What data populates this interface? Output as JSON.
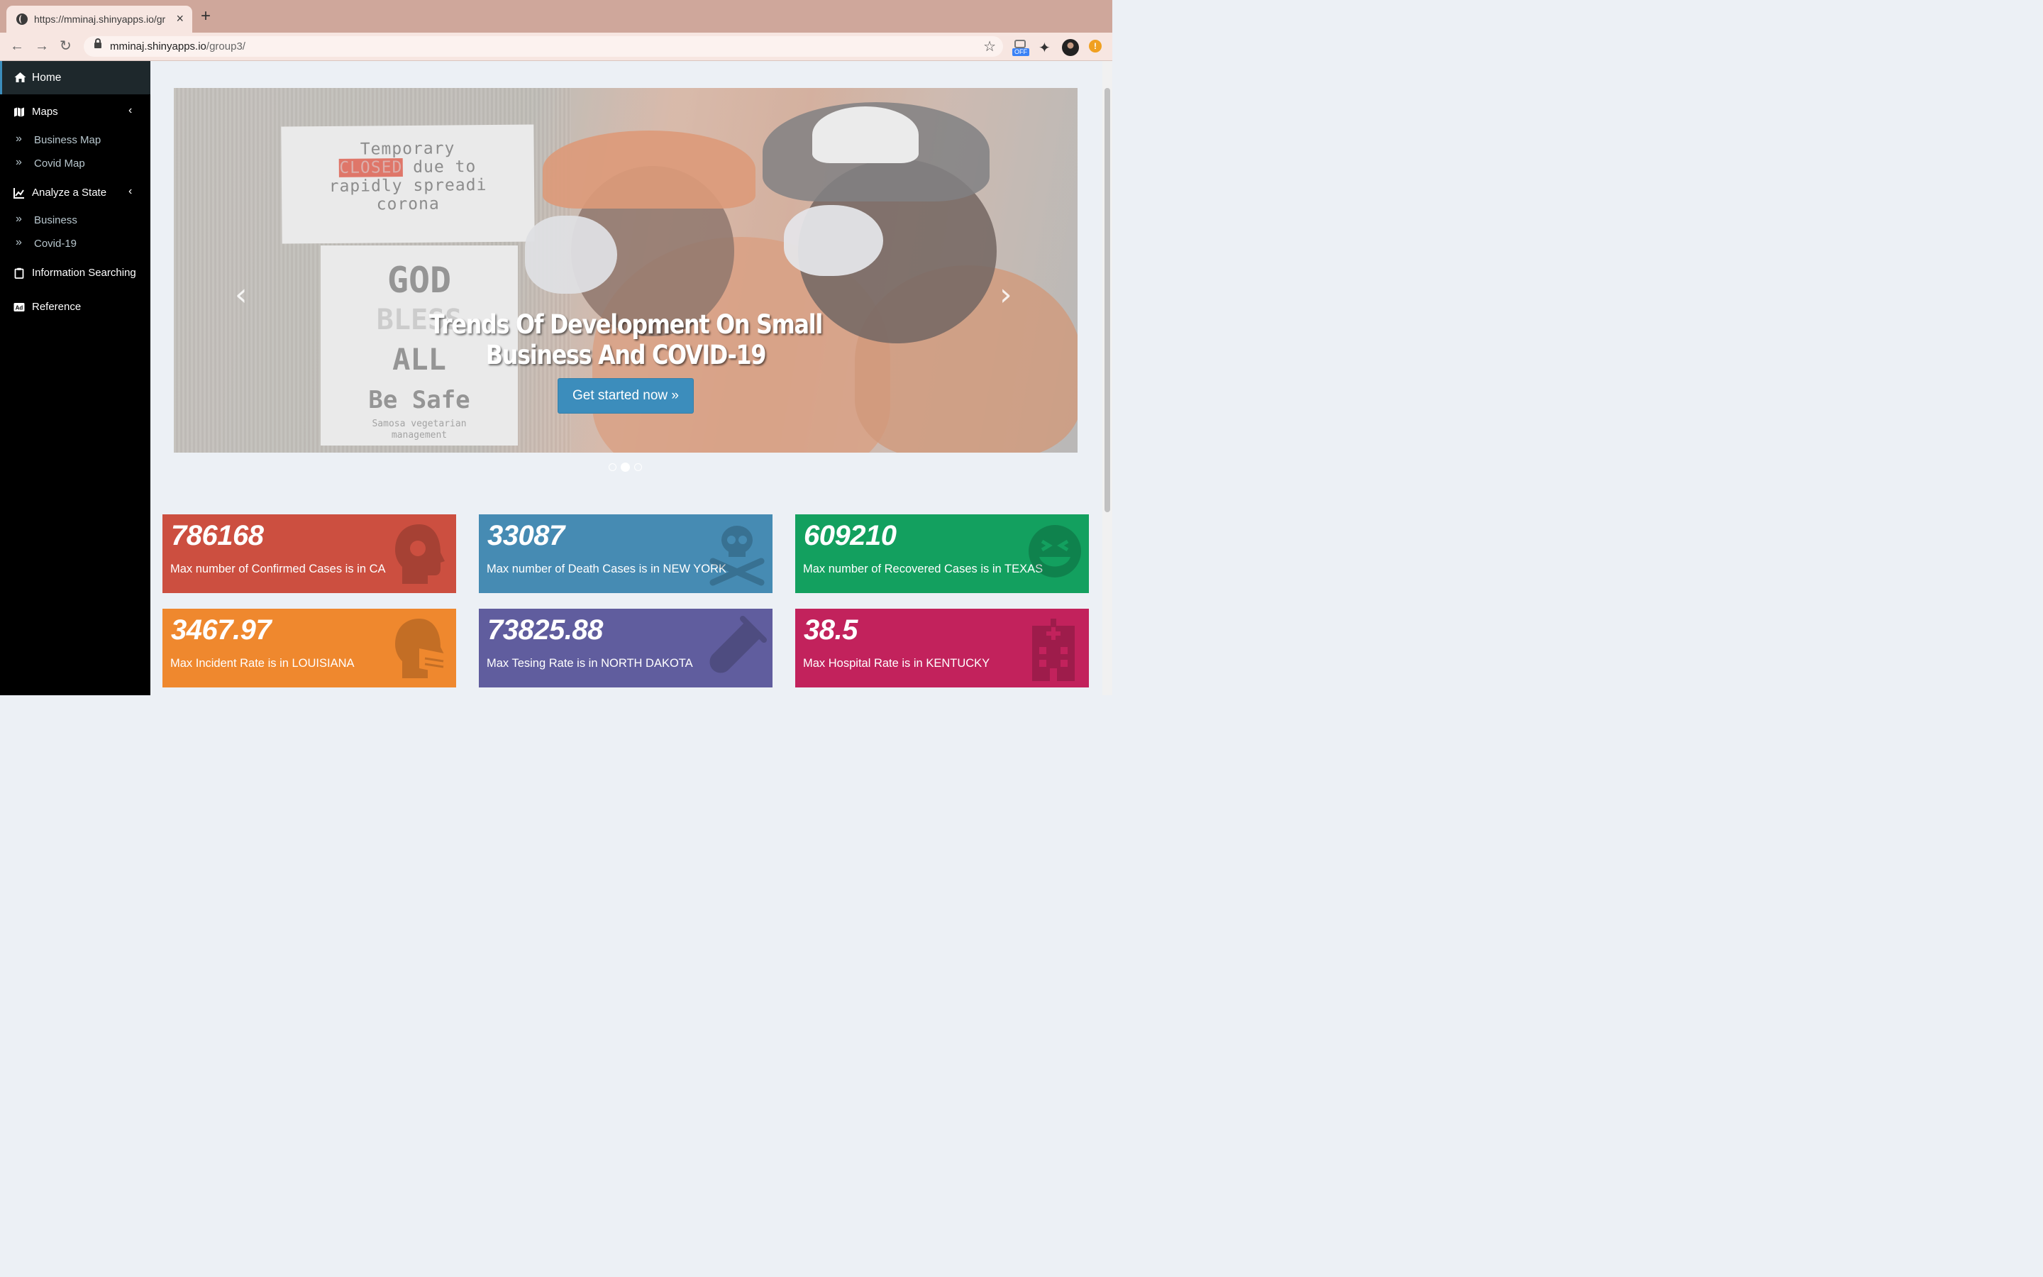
{
  "browser": {
    "tab_title": "https://mminaj.shinyapps.io/gr",
    "tab_close": "×",
    "new_tab": "+",
    "url_host": "mminaj.shinyapps.io",
    "url_path": "/group3/",
    "ext_off_label": "OFF",
    "alert_glyph": "!"
  },
  "sidebar": {
    "home": "Home",
    "maps": "Maps",
    "business_map": "Business Map",
    "covid_map": "Covid Map",
    "analyze_state": "Analyze a State",
    "business": "Business",
    "covid19": "Covid-19",
    "info_search": "Information Searching",
    "reference": "Reference",
    "accent_color": "#3c8dbc"
  },
  "carousel": {
    "sign_line1": "Temporary",
    "sign_line2_red": "CLOSED",
    "sign_line2_rest": " due to",
    "sign_line3": "rapidly spreadi",
    "sign_line4": "corona",
    "sign2_god": "GOD",
    "sign2_bless": "BLESS",
    "sign2_all": "ALL",
    "sign2_safe": "Be Safe",
    "sign2_small1": "Samosa vegetarian",
    "sign2_small2": "management",
    "title": "Trends Of Development On Small Business And COVID-19",
    "button": "Get started now »",
    "prev": "‹",
    "next": "›",
    "active_slide": 2,
    "slide_count": 3
  },
  "value_boxes": [
    {
      "value": "786168",
      "caption": "Max number of Confirmed Cases is in CA",
      "color": "#dd4b39",
      "icon": "virus-head-icon"
    },
    {
      "value": "33087",
      "caption": "Max number of Death Cases is in NEW YORK",
      "color": "#3c8dbc",
      "icon": "skull-crossbones-icon"
    },
    {
      "value": "609210",
      "caption": "Max number of Recovered Cases is in TEXAS",
      "color": "#00a65a",
      "icon": "grin-squint-icon"
    },
    {
      "value": "3467.97",
      "caption": "Max Incident Rate is in LOUISIANA",
      "color": "#ff851b",
      "icon": "head-mask-icon"
    },
    {
      "value": "73825.88",
      "caption": "Max Tesing Rate is in NORTH DAKOTA",
      "color": "#605ca8",
      "icon": "test-tube-icon"
    },
    {
      "value": "38.5",
      "caption": "Max Hospital Rate is in KENTUCKY",
      "color": "#d81b60",
      "icon": "hospital-icon"
    }
  ]
}
